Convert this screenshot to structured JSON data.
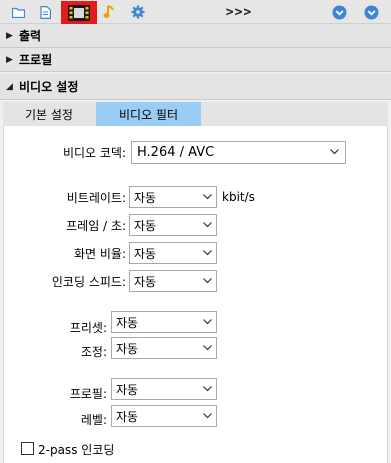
{
  "toolbar": {
    "buttons": [
      {
        "name": "folder-icon"
      },
      {
        "name": "document-icon"
      },
      {
        "name": "film-icon",
        "selected": true
      },
      {
        "name": "music-note-icon"
      },
      {
        "name": "gear-icon"
      }
    ],
    "more_label": ">>>",
    "right_buttons": [
      {
        "name": "chevron-down-circle-icon"
      },
      {
        "name": "chevron-down-circle-icon"
      }
    ]
  },
  "sections": {
    "output": {
      "label": "출력",
      "expanded": false
    },
    "profile": {
      "label": "프로필",
      "expanded": false
    },
    "video": {
      "label": "비디오 설정",
      "expanded": true
    }
  },
  "tabs": [
    {
      "label": "기본 설정",
      "active": false
    },
    {
      "label": "비디오 필터",
      "active": true
    }
  ],
  "form": {
    "codec": {
      "label": "비디오 코덱:",
      "value": "H.264 / AVC"
    },
    "bitrate": {
      "label": "비트레이트:",
      "value": "자동",
      "unit": "kbit/s"
    },
    "framerate": {
      "label": "프레임 / 초:",
      "value": "자동"
    },
    "aspect": {
      "label": "화면 비율:",
      "value": "자동"
    },
    "encoding_speed": {
      "label": "인코딩 스피드:",
      "value": "자동"
    },
    "preset": {
      "label": "프리셋:",
      "value": "자동"
    },
    "tune": {
      "label": "조정:",
      "value": "자동"
    },
    "profile": {
      "label": "프로필:",
      "value": "자동"
    },
    "level": {
      "label": "레벨:",
      "value": "자동"
    },
    "twopass": {
      "label": "2-pass 인코딩",
      "checked": false
    }
  },
  "colors": {
    "selected_toolbar_button": "#e51b1b",
    "active_tab": "#99cdf5",
    "icon_blue": "#3d86d6",
    "music_note": "#f5a000"
  }
}
